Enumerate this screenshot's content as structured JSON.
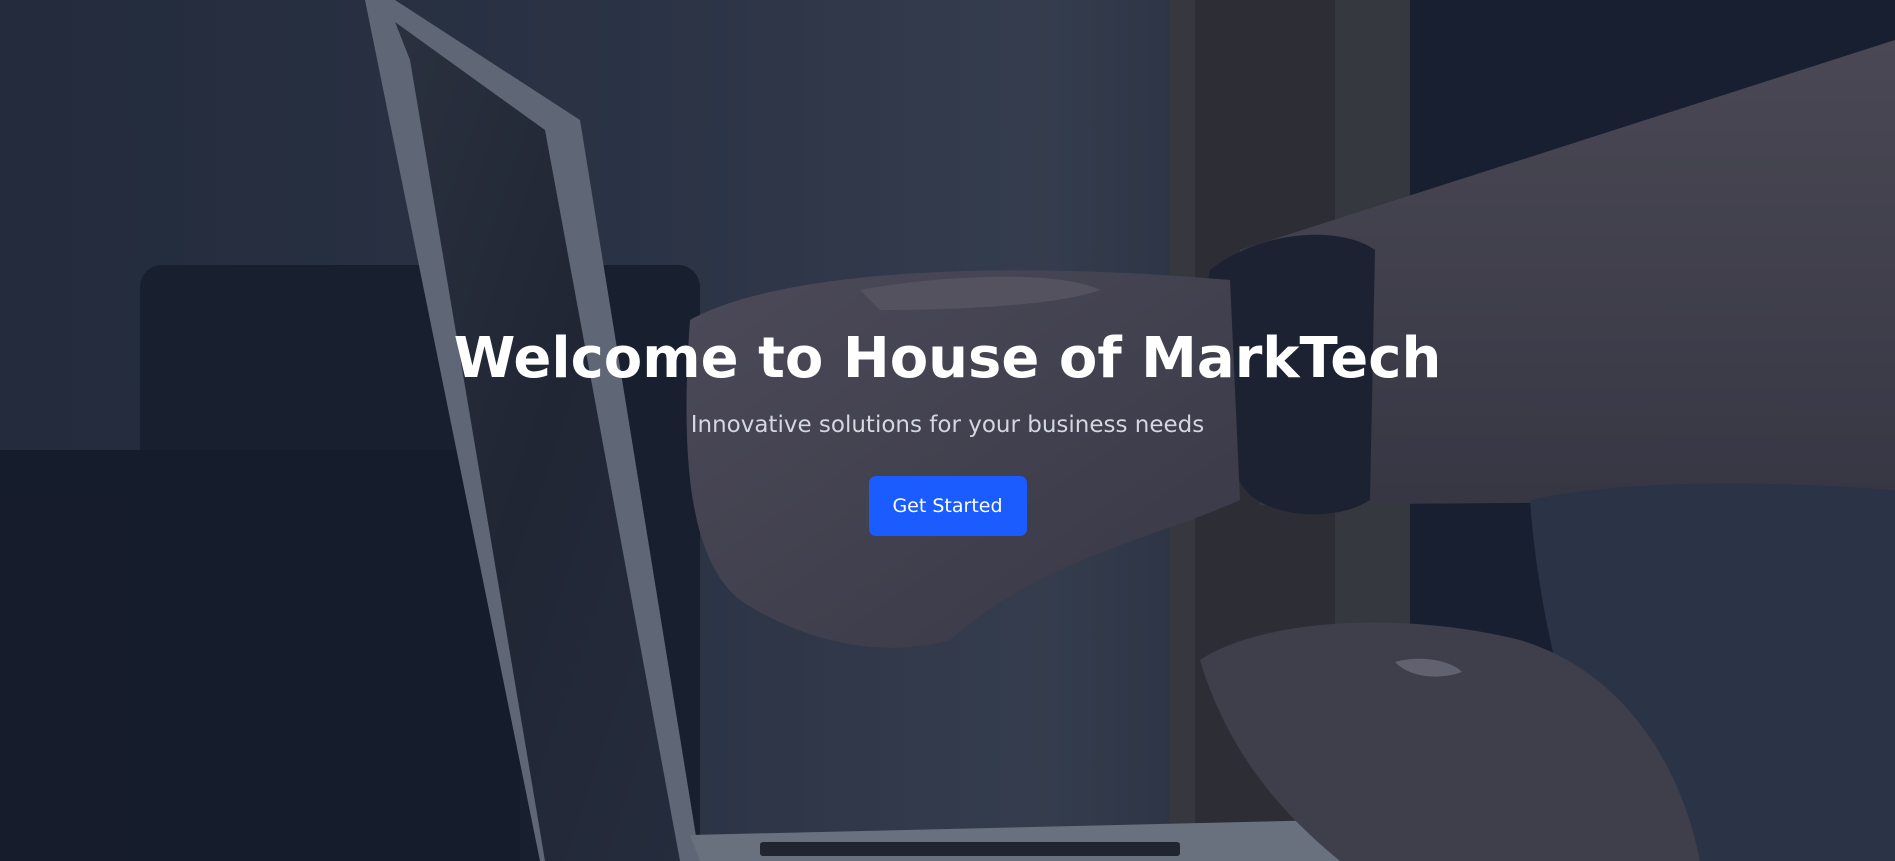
{
  "hero": {
    "title": "Welcome to House of MarkTech",
    "subtitle": "Innovative solutions for your business needs",
    "cta_label": "Get Started"
  },
  "colors": {
    "accent": "#1a5cff",
    "title_text": "#ffffff",
    "subtitle_text": "#d3d7e0",
    "overlay": "#1c2233"
  }
}
